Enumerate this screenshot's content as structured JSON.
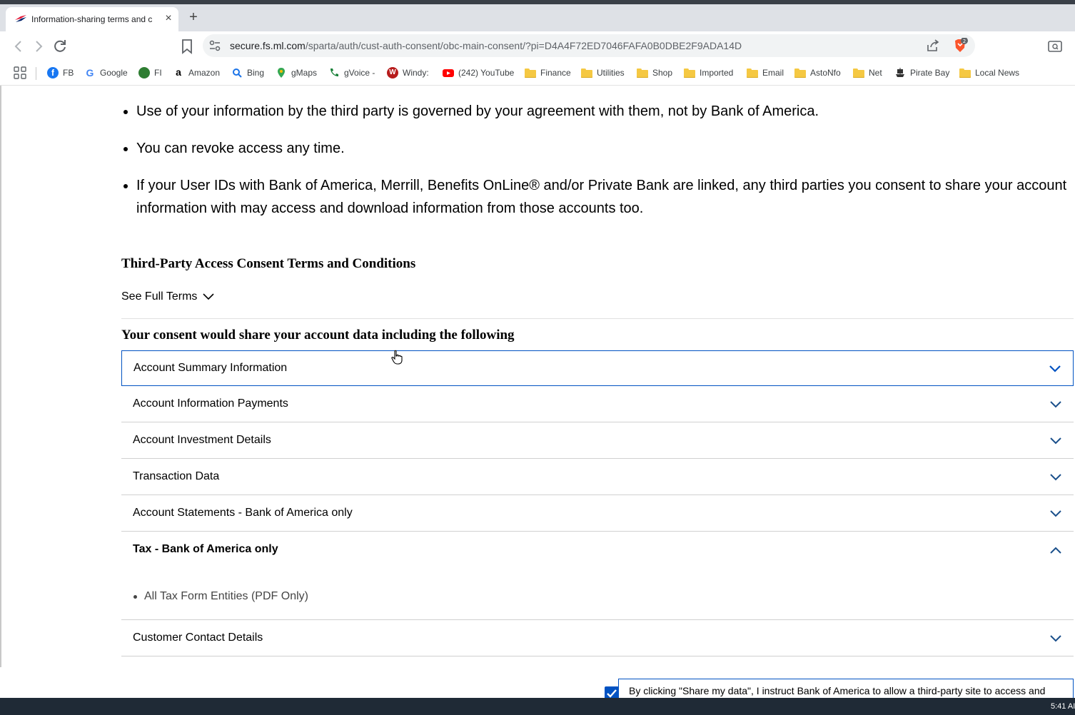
{
  "browser": {
    "tab_title": "Information-sharing terms and c",
    "new_tab": "+",
    "close": "×",
    "url_host": "secure.fs.ml.com",
    "url_path": "/sparta/auth/cust-auth-consent/obc-main-consent/?pi=D4A4F72ED7046FAFA0B0DBE2F9ADA14D",
    "brave_badge": "2"
  },
  "bookmarks": [
    {
      "label": "FB",
      "icon": "facebook-icon",
      "color": "#1877f2"
    },
    {
      "label": "Google",
      "icon": "google-icon",
      "color": "#4285f4"
    },
    {
      "label": "FI",
      "icon": "fi-icon",
      "color": "#2e7d32"
    },
    {
      "label": "Amazon",
      "icon": "amazon-icon",
      "color": "#000000"
    },
    {
      "label": "Bing",
      "icon": "bing-search-icon",
      "color": "#1a73e8"
    },
    {
      "label": "gMaps",
      "icon": "maps-pin-icon",
      "color": "#34a853"
    },
    {
      "label": "gVoice -",
      "icon": "phone-icon",
      "color": "#188038"
    },
    {
      "label": "Windy:",
      "icon": "windy-icon",
      "color": "#b71c1c"
    },
    {
      "label": "(242) YouTube",
      "icon": "youtube-icon",
      "color": "#ff0000"
    },
    {
      "label": "Finance",
      "icon": "folder-icon"
    },
    {
      "label": "Utilities",
      "icon": "folder-icon"
    },
    {
      "label": "Shop",
      "icon": "folder-icon"
    },
    {
      "label": "Imported",
      "icon": "folder-icon"
    },
    {
      "label": "Email",
      "icon": "folder-icon"
    },
    {
      "label": "AstoNfo",
      "icon": "folder-icon"
    },
    {
      "label": "Net",
      "icon": "folder-icon"
    },
    {
      "label": "Pirate Bay",
      "icon": "pirate-ship-icon"
    },
    {
      "label": "Local News",
      "icon": "folder-icon"
    }
  ],
  "content": {
    "bullets": [
      "Use of your information by the third party is governed by your agreement with them, not by Bank of America.",
      "You can revoke access any time.",
      "If your User IDs with Bank of America, Merrill, Benefits OnLine® and/or Private Bank are linked, any third parties you consent to share your account information with may access and download information from those accounts too."
    ],
    "terms_heading": "Third-Party Access Consent Terms and Conditions",
    "see_full_terms": "See Full Terms",
    "consent_heading": "Your consent would share your account data including the following",
    "accordion": [
      {
        "label": "Account Summary Information",
        "state": "collapsed-focused"
      },
      {
        "label": "Account Information Payments",
        "state": "collapsed"
      },
      {
        "label": "Account Investment Details",
        "state": "collapsed"
      },
      {
        "label": "Transaction Data",
        "state": "collapsed"
      },
      {
        "label": "Account Statements - Bank of America only",
        "state": "collapsed"
      },
      {
        "label": "Tax - Bank of America only",
        "state": "expanded",
        "items": [
          "All Tax Form Entities (PDF Only)"
        ]
      },
      {
        "label": "Customer Contact Details",
        "state": "collapsed"
      }
    ],
    "consent_text": "By clicking \"Share my data\", I instruct Bank of America to allow a third-party site to access and",
    "consent_checked": true
  },
  "taskbar": {
    "clock": "5:41 AI"
  },
  "colors": {
    "accent": "#0052c2",
    "chevron": "#1a4f8b",
    "brave": "#fb542b"
  }
}
